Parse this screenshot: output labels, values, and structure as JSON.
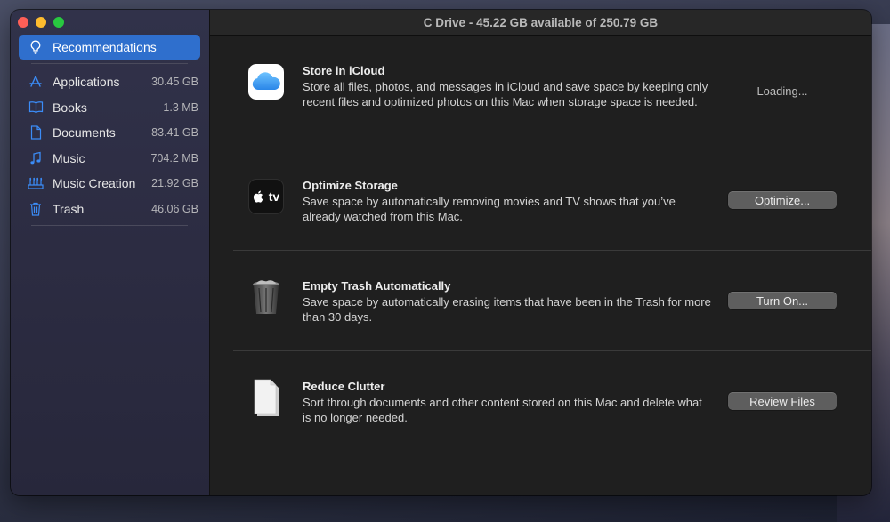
{
  "window": {
    "title": "C Drive - 45.22 GB available of 250.79 GB"
  },
  "sidebar": {
    "items": [
      {
        "label": "Recommendations",
        "size": "",
        "icon": "lightbulb-icon",
        "selected": true
      },
      {
        "label": "Applications",
        "size": "30.45 GB",
        "icon": "app-store-icon"
      },
      {
        "label": "Books",
        "size": "1.3 MB",
        "icon": "book-icon"
      },
      {
        "label": "Documents",
        "size": "83.41 GB",
        "icon": "document-icon"
      },
      {
        "label": "Music",
        "size": "704.2 MB",
        "icon": "music-note-icon"
      },
      {
        "label": "Music Creation",
        "size": "21.92 GB",
        "icon": "music-creation-icon"
      },
      {
        "label": "Trash",
        "size": "46.06 GB",
        "icon": "trash-icon"
      }
    ]
  },
  "recommendations": [
    {
      "title": "Store in iCloud",
      "description": "Store all files, photos, and messages in iCloud and save space by keeping only recent files and optimized photos on this Mac when storage space is needed.",
      "status": "Loading...",
      "icon": "icloud-icon"
    },
    {
      "title": "Optimize Storage",
      "description": "Save space by automatically removing movies and TV shows that you’ve already watched from this Mac.",
      "button": "Optimize...",
      "icon": "apple-tv-icon",
      "icon_text": "tv"
    },
    {
      "title": "Empty Trash Automatically",
      "description": "Save space by automatically erasing items that have been in the Trash for more than 30 days.",
      "button": "Turn On...",
      "icon": "full-trash-icon"
    },
    {
      "title": "Reduce Clutter",
      "description": "Sort through documents and other content stored on this Mac and delete what is no longer needed.",
      "button": "Review Files",
      "icon": "documents-stack-icon"
    }
  ],
  "colors": {
    "accent": "#2f6fcd",
    "sidebar_icon": "#3b8cf7",
    "window_bg": "#1f1f1f"
  }
}
